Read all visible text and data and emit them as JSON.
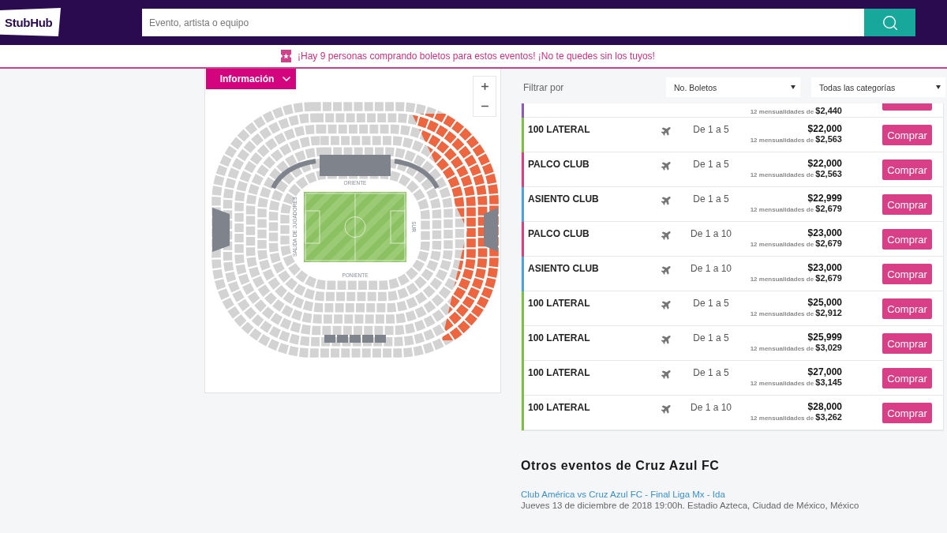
{
  "header": {
    "logo": "StubHub",
    "search": {
      "placeholder": "Evento, artista o equipo"
    }
  },
  "alert": {
    "text": "¡Hay 9 personas comprando boletos para estos eventos! ¡No te quedes sin los tuyos!"
  },
  "map_panel": {
    "info_tab": "Información",
    "stand_labels": {
      "top": "ORIENTE",
      "bottom": "PONIENTE",
      "left": "SALIDA DE JUGADORES",
      "right": "SUR"
    }
  },
  "filters": {
    "label": "Filtrar por",
    "selects": [
      {
        "value": "No. Boletos"
      },
      {
        "value": "Todas las categorías"
      }
    ]
  },
  "listings": [
    {
      "kind": "partial",
      "color": "#8e5cb5",
      "installments": "12 mensualidades de **$2,440**"
    },
    {
      "kind": "full",
      "color": "#7cc242",
      "section": "100 LATERAL",
      "quantity": "De 1 a 5",
      "price": "$22,000",
      "installments": "12 mensualidades de **$2,563**",
      "button": "Comprar"
    },
    {
      "kind": "full",
      "color": "#d8407f",
      "section": "PALCO CLUB",
      "quantity": "De 1 a 5",
      "price": "$22,000",
      "installments": "12 mensualidades de **$2,563**",
      "button": "Comprar"
    },
    {
      "kind": "full",
      "color": "#4aa6e0",
      "section": "ASIENTO CLUB",
      "quantity": "De 1 a 5",
      "price": "$22,999",
      "installments": "12 mensualidades de **$2,679**",
      "button": "Comprar"
    },
    {
      "kind": "full",
      "color": "#d8407f",
      "section": "PALCO CLUB",
      "quantity": "De 1 a 10",
      "price": "$23,000",
      "installments": "12 mensualidades de **$2,679**",
      "button": "Comprar"
    },
    {
      "kind": "full",
      "color": "#4aa6e0",
      "section": "ASIENTO CLUB",
      "quantity": "De 1 a 10",
      "price": "$23,000",
      "installments": "12 mensualidades de **$2,679**",
      "button": "Comprar"
    },
    {
      "kind": "full",
      "color": "#7cc242",
      "section": "100 LATERAL",
      "quantity": "De 1 a 5",
      "price": "$25,000",
      "installments": "12 mensualidades de **$2,912**",
      "button": "Comprar"
    },
    {
      "kind": "full",
      "color": "#7cc242",
      "section": "100 LATERAL",
      "quantity": "De 1 a 5",
      "price": "$25,999",
      "installments": "12 mensualidades de **$3,029**",
      "button": "Comprar"
    },
    {
      "kind": "full",
      "color": "#7cc242",
      "section": "100 LATERAL",
      "quantity": "De 1 a 5",
      "price": "$27,000",
      "installments": "12 mensualidades de **$3,145**",
      "button": "Comprar"
    },
    {
      "kind": "full",
      "color": "#7cc242",
      "section": "100 LATERAL",
      "quantity": "De 1 a 10",
      "price": "$28,000",
      "installments": "12 mensualidades de **$3,262**",
      "button": "Comprar"
    }
  ],
  "other_events": {
    "title": "Otros eventos de Cruz Azul FC",
    "events": [
      {
        "title": "Club América vs Cruz Azul FC - Final Liga Mx - Ida",
        "details": "Jueves 13 de diciembre de 2018 19:00h. Estadio Azteca, Ciudad de México, México"
      }
    ]
  }
}
